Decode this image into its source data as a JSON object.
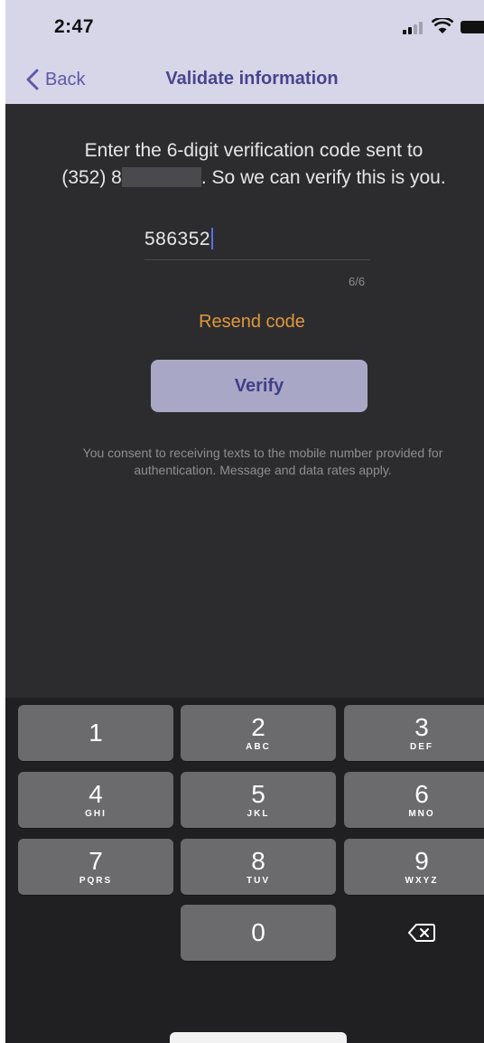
{
  "status_bar": {
    "time": "2:47"
  },
  "nav": {
    "back_label": "Back",
    "title": "Validate information"
  },
  "instruction": {
    "line1": "Enter the 6-digit verification code sent to",
    "phone_prefix": "(352) 8",
    "line2_suffix": ". So we can verify this is you."
  },
  "code_input": {
    "value": "586352",
    "counter": "6/6"
  },
  "resend_label": "Resend code",
  "verify_label": "Verify",
  "consent_text": "You consent to receiving texts to the mobile number provided for authentication. Message and data rates apply.",
  "colors": {
    "nav_bg": "#d7d5e8",
    "accent": "#46468f",
    "resend": "#e0973d",
    "verify_bg": "#a9a7c6",
    "background": "#2c2c2e"
  },
  "keypad": {
    "keys": [
      {
        "num": "1",
        "letters": ""
      },
      {
        "num": "2",
        "letters": "ABC"
      },
      {
        "num": "3",
        "letters": "DEF"
      },
      {
        "num": "4",
        "letters": "GHI"
      },
      {
        "num": "5",
        "letters": "JKL"
      },
      {
        "num": "6",
        "letters": "MNO"
      },
      {
        "num": "7",
        "letters": "PQRS"
      },
      {
        "num": "8",
        "letters": "TUV"
      },
      {
        "num": "9",
        "letters": "WXYZ"
      },
      {
        "num": "0",
        "letters": ""
      }
    ],
    "delete_icon": "backspace-icon"
  }
}
